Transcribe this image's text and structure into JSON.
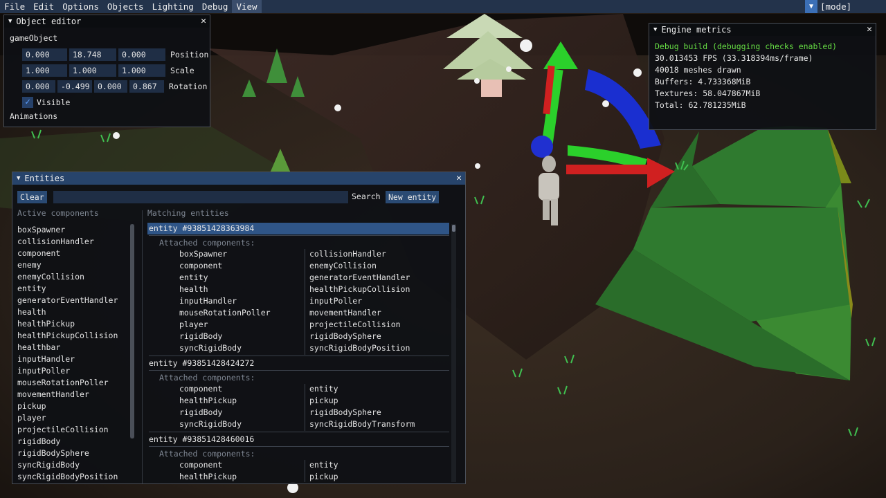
{
  "menubar": {
    "items": [
      "File",
      "Edit",
      "Options",
      "Objects",
      "Lighting",
      "Debug",
      "View"
    ],
    "mode_label": "[mode]"
  },
  "object_editor": {
    "title": "Object editor",
    "object_name": "gameObject",
    "position": {
      "values": [
        "0.000",
        "18.748",
        "0.000"
      ],
      "label": "Position"
    },
    "scale": {
      "values": [
        "1.000",
        "1.000",
        "1.000"
      ],
      "label": "Scale"
    },
    "rotation": {
      "values": [
        "0.000",
        "-0.499",
        "0.000",
        "0.867"
      ],
      "label": "Rotation"
    },
    "visible_label": "Visible",
    "visible_checked": true,
    "animations_label": "Animations"
  },
  "metrics": {
    "title": "Engine metrics",
    "debug_line": "Debug build (debugging checks enabled)",
    "fps": "30.013453 FPS (33.318394ms/frame)",
    "meshes": "40018 meshes drawn",
    "buffers": "Buffers: 4.733368MiB",
    "textures": "Textures: 58.047867MiB",
    "total": "Total: 62.781235MiB"
  },
  "entities": {
    "title": "Entities",
    "clear_label": "Clear",
    "search_label": "Search",
    "new_entity_label": "New entity",
    "active_components_header": "Active components",
    "matching_entities_header": "Matching entities",
    "attached_label": "Attached components:",
    "active_components": [
      "boxSpawner",
      "collisionHandler",
      "component",
      "enemy",
      "enemyCollision",
      "entity",
      "generatorEventHandler",
      "health",
      "healthPickup",
      "healthPickupCollision",
      "healthbar",
      "inputHandler",
      "inputPoller",
      "mouseRotationPoller",
      "movementHandler",
      "pickup",
      "player",
      "projectileCollision",
      "rigidBody",
      "rigidBodySphere",
      "syncRigidBody",
      "syncRigidBodyPosition"
    ],
    "matching": [
      {
        "id": "entity #93851428363984",
        "components": [
          [
            "boxSpawner",
            "collisionHandler"
          ],
          [
            "component",
            "enemyCollision"
          ],
          [
            "entity",
            "generatorEventHandler"
          ],
          [
            "health",
            "healthPickupCollision"
          ],
          [
            "inputHandler",
            "inputPoller"
          ],
          [
            "mouseRotationPoller",
            "movementHandler"
          ],
          [
            "player",
            "projectileCollision"
          ],
          [
            "rigidBody",
            "rigidBodySphere"
          ],
          [
            "syncRigidBody",
            "syncRigidBodyPosition"
          ]
        ]
      },
      {
        "id": "entity #93851428424272",
        "components": [
          [
            "component",
            "entity"
          ],
          [
            "healthPickup",
            "pickup"
          ],
          [
            "rigidBody",
            "rigidBodySphere"
          ],
          [
            "syncRigidBody",
            "syncRigidBodyTransform"
          ]
        ]
      },
      {
        "id": "entity #93851428460016",
        "components": [
          [
            "component",
            "entity"
          ],
          [
            "healthPickup",
            "pickup"
          ]
        ]
      }
    ]
  },
  "colors": {
    "menubar": "#23334b",
    "accent": "#3b6fb6",
    "field": "#1f2e45",
    "debug_green": "#66dd44"
  }
}
